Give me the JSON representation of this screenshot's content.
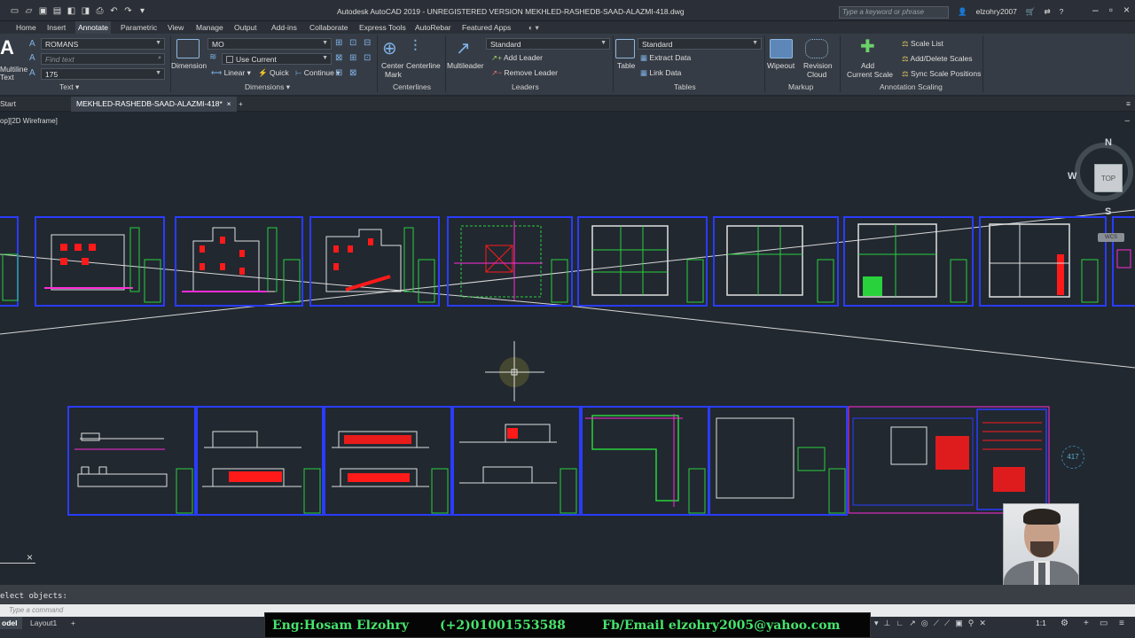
{
  "window": {
    "title": "Autodesk AutoCAD 2019 - UNREGISTERED VERSION   MEKHLED-RASHEDB-SAAD-ALAZMI-418.dwg",
    "search_placeholder": "Type a keyword or phrase",
    "user": "elzohry2007"
  },
  "menu_tabs": [
    "Home",
    "Insert",
    "Annotate",
    "Parametric",
    "View",
    "Manage",
    "Output",
    "Add-ins",
    "Collaborate",
    "Express Tools",
    "AutoRebar",
    "Featured Apps"
  ],
  "active_tab": "Annotate",
  "ribbon": {
    "text_panel": {
      "multiline_label": "Multiline",
      "text_label": "Text",
      "style_value": "ROMANS",
      "find_placeholder": "Find text",
      "height_value": "175",
      "title": "Text"
    },
    "dimensions_panel": {
      "dimension_label": "Dimension",
      "style_value": "MO",
      "layer_value": "Use Current",
      "linear_label": "Linear",
      "quick_label": "Quick",
      "continue_label": "Continue",
      "title": "Dimensions"
    },
    "centerlines_panel": {
      "center_mark_label_1": "Center",
      "center_mark_label_2": "Mark",
      "centerline_label": "Centerline",
      "title": "Centerlines"
    },
    "leaders_panel": {
      "multileader_label": "Multileader",
      "style_value": "Standard",
      "add_leader_label": "Add Leader",
      "remove_leader_label": "Remove Leader",
      "title": "Leaders"
    },
    "tables_panel": {
      "table_label": "Table",
      "style_value": "Standard",
      "extract_data_label": "Extract Data",
      "link_data_label": "Link Data",
      "title": "Tables"
    },
    "markup_panel": {
      "wipeout_label": "Wipeout",
      "revision_label_1": "Revision",
      "revision_label_2": "Cloud",
      "title": "Markup"
    },
    "scaling_panel": {
      "add_label_1": "Add",
      "add_label_2": "Current Scale",
      "scale_list_label": "Scale List",
      "add_delete_label": "Add/Delete Scales",
      "sync_label": "Sync Scale Positions",
      "title": "Annotation Scaling"
    }
  },
  "file_tabs": {
    "start": "Start",
    "active_file": "MEKHLED-RASHEDB-SAAD-ALAZMI-418*"
  },
  "viewport": {
    "label": "op][2D Wireframe]",
    "viewcube_top": "TOP",
    "compass_n": "N",
    "compass_w": "W",
    "compass_s": "S",
    "wcs_label": "WCS",
    "sheet_number": "417"
  },
  "command": {
    "history": "elect objects:",
    "input_placeholder": "Type a command"
  },
  "layout_tabs": [
    "odel",
    "Layout1"
  ],
  "status": {
    "scale": "1:1"
  },
  "overlay": {
    "name": "Eng:Hosam Elzohry",
    "phone": "(+2)01001553588",
    "contact": "Fb/Email elzohry2005@yahoo.com"
  },
  "colors": {
    "frame": "#2a3cff",
    "cad_green": "#29d13c",
    "cad_magenta": "#ff2bd8",
    "cad_red": "#ff1a1a",
    "banner_text": "#47e36d"
  }
}
